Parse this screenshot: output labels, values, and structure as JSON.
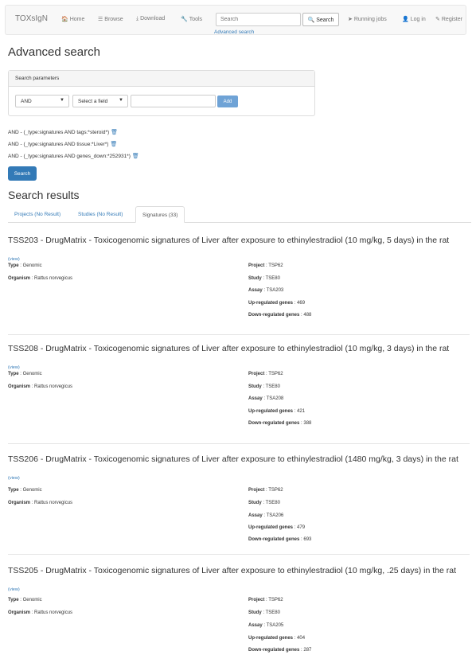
{
  "navbar": {
    "brand": "TOXsIgN",
    "items": [
      {
        "icon": "home-icon",
        "glyph": "🏠",
        "label": "Home"
      },
      {
        "icon": "list-icon",
        "glyph": "☰",
        "label": "Browse"
      },
      {
        "icon": "download-icon",
        "glyph": "⤓",
        "label": "Download"
      },
      {
        "icon": "wrench-icon",
        "glyph": "🔧",
        "label": "Tools"
      }
    ],
    "search_placeholder": "Search",
    "search_button": "Search",
    "advanced_link": "Advanced search",
    "right_items": [
      {
        "icon": "send-icon",
        "glyph": "➤",
        "label": "Running jobs"
      },
      {
        "icon": "user-icon",
        "glyph": "👤",
        "label": "Log in"
      },
      {
        "icon": "pencil-icon",
        "glyph": "✎",
        "label": "Register"
      }
    ]
  },
  "page_title": "Advanced search",
  "search_params": {
    "heading": "Search parameters",
    "operator": "AND",
    "field": "Select a field",
    "value": "",
    "add_label": "Add"
  },
  "queries": [
    "AND - (_type:signatures AND tags:*steroid*)",
    "AND - (_type:signatures AND tissue:*Liver*)",
    "AND - (_type:signatures AND genes_down:*252931*)"
  ],
  "search_button": "Search",
  "results_title": "Search results",
  "tabs": [
    "Projects (No Result)",
    "Studies (No Result)",
    "Signatures (33)"
  ],
  "labels": {
    "view": "(view)",
    "type": "Type",
    "organism": "Organism",
    "project": "Project",
    "study": "Study",
    "assay": "Assay",
    "up": "Up-regulated genes",
    "down": "Down-regulated genes"
  },
  "results": [
    {
      "title": "TSS203 - DrugMatrix - Toxicogenomic signatures of Liver after exposure to ethinylestradiol (10 mg/kg, 5 days) in the rat",
      "type": "Genomic",
      "organism": "Rattus norvegicus",
      "project": "TSP62",
      "study": "TSE80",
      "assay": "TSA203",
      "up": "469",
      "down": "488"
    },
    {
      "title": "TSS208 - DrugMatrix - Toxicogenomic signatures of Liver after exposure to ethinylestradiol (10 mg/kg, 3 days) in the rat",
      "type": "Genomic",
      "organism": "Rattus norvegicus",
      "project": "TSP62",
      "study": "TSE80",
      "assay": "TSA208",
      "up": "421",
      "down": "388"
    },
    {
      "title": "TSS206 - DrugMatrix - Toxicogenomic signatures of Liver after exposure to ethinylestradiol (1480 mg/kg, 3 days) in the rat",
      "type": "Genomic",
      "organism": "Rattus norvegicus",
      "project": "TSP62",
      "study": "TSE80",
      "assay": "TSA206",
      "up": "479",
      "down": "693"
    },
    {
      "title": "TSS205 - DrugMatrix - Toxicogenomic signatures of Liver after exposure to ethinylestradiol (10 mg/kg, .25 days) in the rat",
      "type": "Genomic",
      "organism": "Rattus norvegicus",
      "project": "TSP62",
      "study": "TSE80",
      "assay": "TSA205",
      "up": "404",
      "down": "287"
    }
  ]
}
